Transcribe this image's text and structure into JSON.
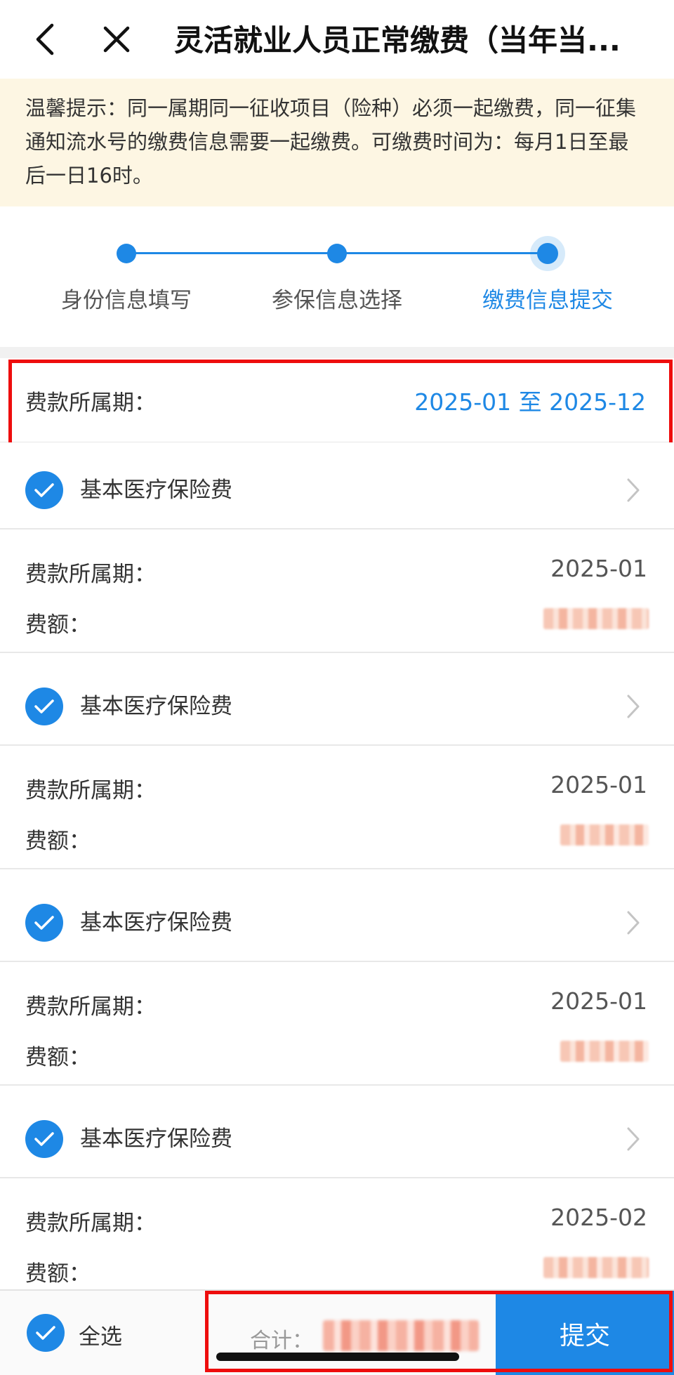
{
  "nav": {
    "title": "灵活就业人员正常缴费（当年当..."
  },
  "tip": {
    "text": "温馨提示：同一属期同一征收项目（险种）必须一起缴费，同一征集通知流水号的缴费信息需要一起缴费。可缴费时间为：每月1日至最后一日16时。"
  },
  "steps": [
    {
      "label": "身份信息填写"
    },
    {
      "label": "参保信息选择"
    },
    {
      "label": "缴费信息提交"
    }
  ],
  "period": {
    "label": "费款所属期：",
    "value": "2025-01 至 2025-12"
  },
  "items": [
    {
      "title": "基本医疗保险费",
      "period_label": "费款所属期：",
      "period_value": "2025-01",
      "amount_label": "费额："
    },
    {
      "title": "基本医疗保险费",
      "period_label": "费款所属期：",
      "period_value": "2025-01",
      "amount_label": "费额："
    },
    {
      "title": "基本医疗保险费",
      "period_label": "费款所属期：",
      "period_value": "2025-01",
      "amount_label": "费额："
    },
    {
      "title": "基本医疗保险费",
      "period_label": "费款所属期：",
      "period_value": "2025-02",
      "amount_label": "费额："
    }
  ],
  "bottom": {
    "select_all": "全选",
    "total_label": "合计：",
    "submit": "提交"
  },
  "colors": {
    "accent": "#1e88e5",
    "highlight": "#ee0d0d",
    "tip_bg": "#fdf6e3"
  }
}
